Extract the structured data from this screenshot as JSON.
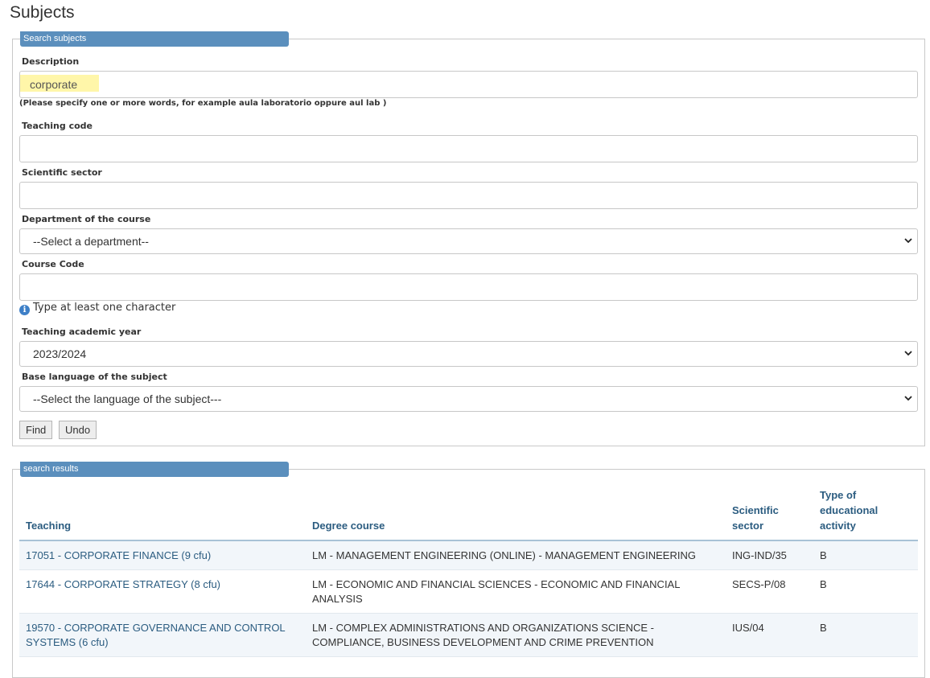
{
  "page": {
    "title": "Subjects"
  },
  "search": {
    "legend": "Search subjects",
    "description_label": "Description",
    "description_value": "corporate",
    "description_hint": "(Please specify one or more words, for example aula laboratorio oppure aul lab )",
    "teaching_code_label": "Teaching code",
    "teaching_code_value": "",
    "scientific_sector_label": "Scientific sector",
    "scientific_sector_value": "",
    "department_label": "Department of the course",
    "department_selected": "--Select a department--",
    "course_code_label": "Course Code",
    "course_code_value": "",
    "course_code_info": "Type at least one character",
    "year_label": "Teaching academic year",
    "year_selected": "2023/2024",
    "language_label": "Base language of the subject",
    "language_selected": "--Select the language of the subject---",
    "find_label": "Find",
    "undo_label": "Undo"
  },
  "results": {
    "legend": "search results",
    "columns": {
      "teaching": "Teaching",
      "degree": "Degree course",
      "sector_1": "Scientific",
      "sector_2": "sector",
      "type_1": "Type of",
      "type_2": "educational",
      "type_3": "activity"
    },
    "rows": [
      {
        "teaching": "17051 - CORPORATE FINANCE (9 cfu)",
        "degree": "LM - MANAGEMENT ENGINEERING (ONLINE) - MANAGEMENT ENGINEERING",
        "sector": "ING-IND/35",
        "type": "B"
      },
      {
        "teaching": "17644 - CORPORATE STRATEGY (8 cfu)",
        "degree": "LM - ECONOMIC AND FINANCIAL SCIENCES - ECONOMIC AND FINANCIAL ANALYSIS",
        "sector": "SECS-P/08",
        "type": "B"
      },
      {
        "teaching": "19570 - CORPORATE GOVERNANCE AND CONTROL SYSTEMS (6 cfu)",
        "degree": "LM - COMPLEX ADMINISTRATIONS AND ORGANIZATIONS SCIENCE - COMPLIANCE, BUSINESS DEVELOPMENT AND CRIME PREVENTION",
        "sector": "IUS/04",
        "type": "B"
      }
    ]
  }
}
